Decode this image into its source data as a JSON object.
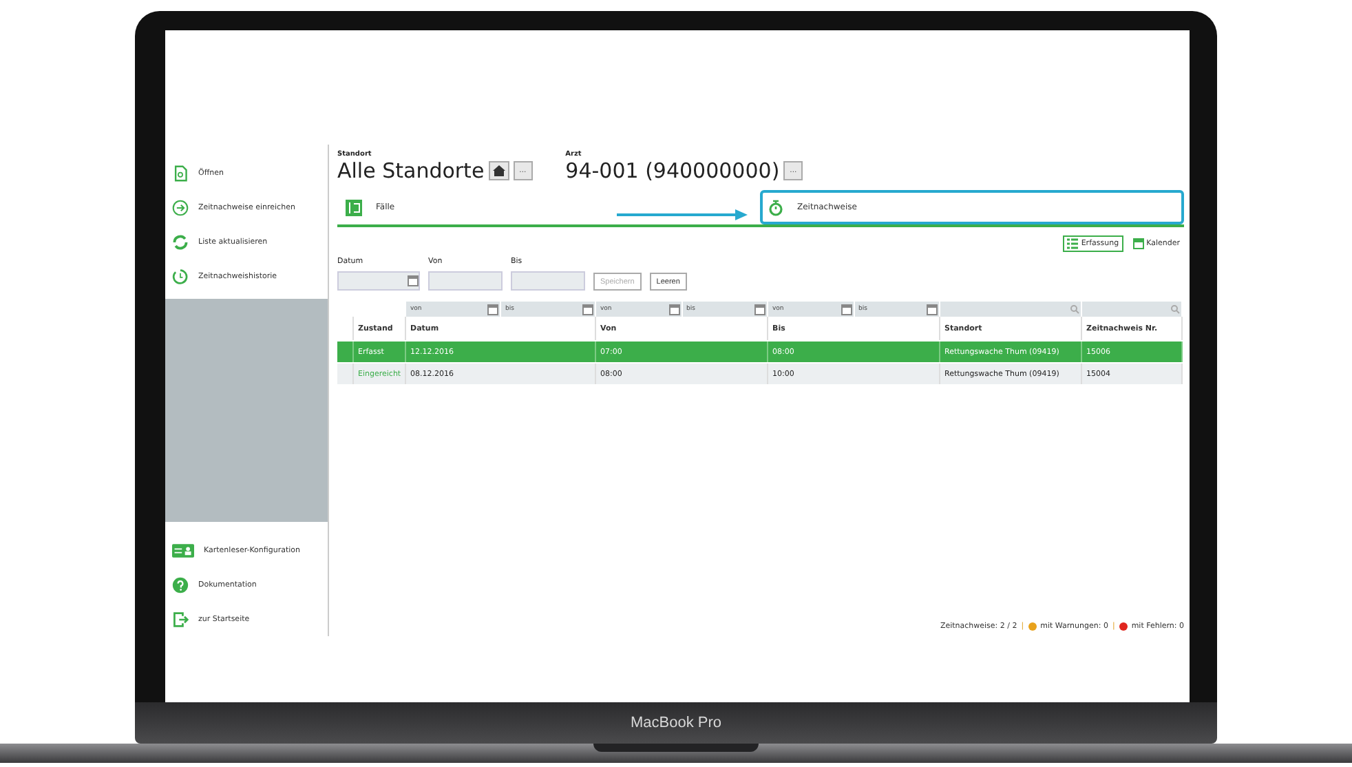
{
  "sidebar": {
    "top_items": [
      {
        "label": "Öffnen"
      },
      {
        "label": "Zeitnachweise einreichen"
      },
      {
        "label": "Liste aktualisieren"
      },
      {
        "label": "Zeitnachweishistorie"
      }
    ],
    "bottom_items": [
      {
        "label": "Kartenleser-Konfiguration"
      },
      {
        "label": "Dokumentation"
      },
      {
        "label": "zur Startseite"
      }
    ]
  },
  "header": {
    "standort": {
      "label": "Standort",
      "value": "Alle Standorte",
      "button": "..."
    },
    "arzt": {
      "label": "Arzt",
      "value": "94-001 (940000000)",
      "button": "..."
    }
  },
  "tabs": [
    {
      "label": "Fälle",
      "selected": false
    },
    {
      "label": "Zeitnachweise",
      "selected": true
    }
  ],
  "view_buttons": [
    {
      "label": "Erfassung",
      "selected": true
    },
    {
      "label": "Kalender",
      "selected": false
    }
  ],
  "form": {
    "fields": [
      {
        "label": "Datum",
        "kind": "date"
      },
      {
        "label": "Von",
        "kind": "text"
      },
      {
        "label": "Bis",
        "kind": "text"
      }
    ],
    "buttons": [
      {
        "label": "Speichern",
        "disabled": true
      },
      {
        "label": "Leeren",
        "disabled": false
      }
    ]
  },
  "table": {
    "columns": [
      {
        "label": "Zustand",
        "filter": {
          "kind": "none"
        }
      },
      {
        "label": "Datum",
        "filter": {
          "kind": "range",
          "from": "von",
          "to": "bis"
        }
      },
      {
        "label": "Von",
        "filter": {
          "kind": "range",
          "from": "von",
          "to": "bis"
        }
      },
      {
        "label": "Bis",
        "filter": {
          "kind": "range",
          "from": "von",
          "to": "bis"
        }
      },
      {
        "label": "Standort",
        "filter": {
          "kind": "search"
        }
      },
      {
        "label": "Zeitnachweis Nr.",
        "filter": {
          "kind": "search"
        }
      }
    ],
    "rows": [
      {
        "selected": true,
        "cells": [
          "Erfasst",
          "12.12.2016",
          "07:00",
          "08:00",
          "Rettungswache Thum (09419)",
          "15006"
        ]
      },
      {
        "selected": false,
        "cells": [
          "Eingereicht",
          "08.12.2016",
          "08:00",
          "10:00",
          "Rettungswache Thum (09419)",
          "15004"
        ]
      }
    ]
  },
  "status_bar": {
    "count": "Zeitnachweise: 2 / 2",
    "separator": "|",
    "legend": [
      {
        "label": "mit Warnungen: 0",
        "color": "#e8a21c"
      },
      {
        "label": "mit Fehlern: 0",
        "color": "#e0261f"
      }
    ]
  },
  "device_label": "MacBook Pro"
}
